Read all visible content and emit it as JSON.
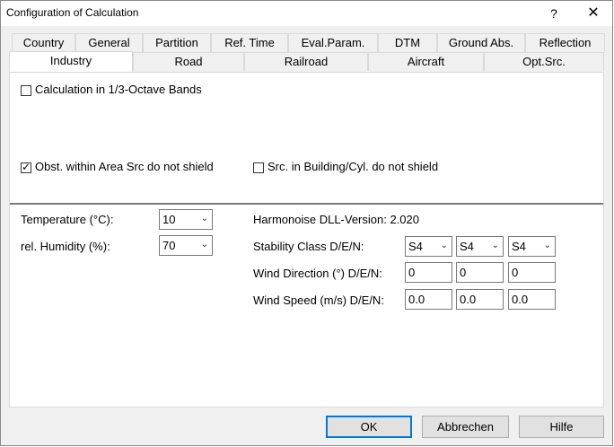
{
  "window": {
    "title": "Configuration of Calculation",
    "help": "?",
    "close": "✕"
  },
  "tabs": {
    "row1": [
      "Country",
      "General",
      "Partition",
      "Ref. Time",
      "Eval.Param.",
      "DTM",
      "Ground Abs.",
      "Reflection"
    ],
    "row2": [
      "Industry",
      "Road",
      "Railroad",
      "Aircraft",
      "Opt.Src."
    ],
    "active": "Industry"
  },
  "options": {
    "octave_bands": {
      "label": "Calculation in 1/3-Octave Bands",
      "checked": false
    },
    "obst_area": {
      "label": "Obst. within Area Src do not shield",
      "checked": true
    },
    "src_building": {
      "label": "Src. in Building/Cyl. do not shield",
      "checked": false
    }
  },
  "meteo": {
    "temperature": {
      "label": "Temperature (°C):",
      "value": "10"
    },
    "humidity": {
      "label": "rel. Humidity (%):",
      "value": "70"
    }
  },
  "harmonoise": {
    "version_label": "Harmonoise DLL-Version: 2.020",
    "stability": {
      "label": "Stability Class D/E/N:",
      "values": [
        "S4",
        "S4",
        "S4"
      ]
    },
    "wind_dir": {
      "label": "Wind Direction (°) D/E/N:",
      "values": [
        "0",
        "0",
        "0"
      ]
    },
    "wind_speed": {
      "label": "Wind Speed (m/s) D/E/N:",
      "values": [
        "0.0",
        "0.0",
        "0.0"
      ]
    }
  },
  "buttons": {
    "ok": "OK",
    "cancel": "Abbrechen",
    "help": "Hilfe"
  }
}
